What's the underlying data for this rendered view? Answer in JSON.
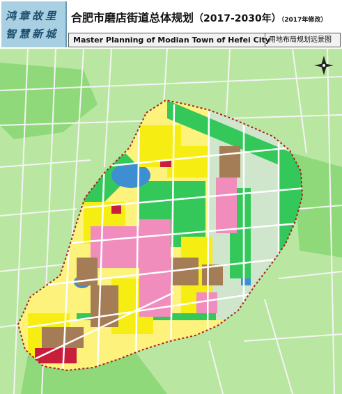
{
  "header": {
    "brand_line1": "鸿章故里",
    "brand_line2": "智慧新城",
    "title_zh": "合肥市磨店街道总体规划",
    "title_years": "（2017-2030年）",
    "title_revision": "（2017年修改）",
    "title_en": "Master Planning of Modian Town of Hefei City",
    "map_type": "用地布局规划远景图"
  },
  "map": {
    "north_arrow": "compass-icon",
    "colors": {
      "background": "#b9e7a1",
      "green_space": "#34c759",
      "dark_green": "#129c2f",
      "residential": "#f6ee12",
      "commercial": "#f08dbd",
      "industrial": "#a47c55",
      "administrative": "#c81e3c",
      "water": "#3d8fd2",
      "logistics": "#cfe6cc",
      "road": "#ffffff",
      "boundary": "#b02020"
    }
  }
}
